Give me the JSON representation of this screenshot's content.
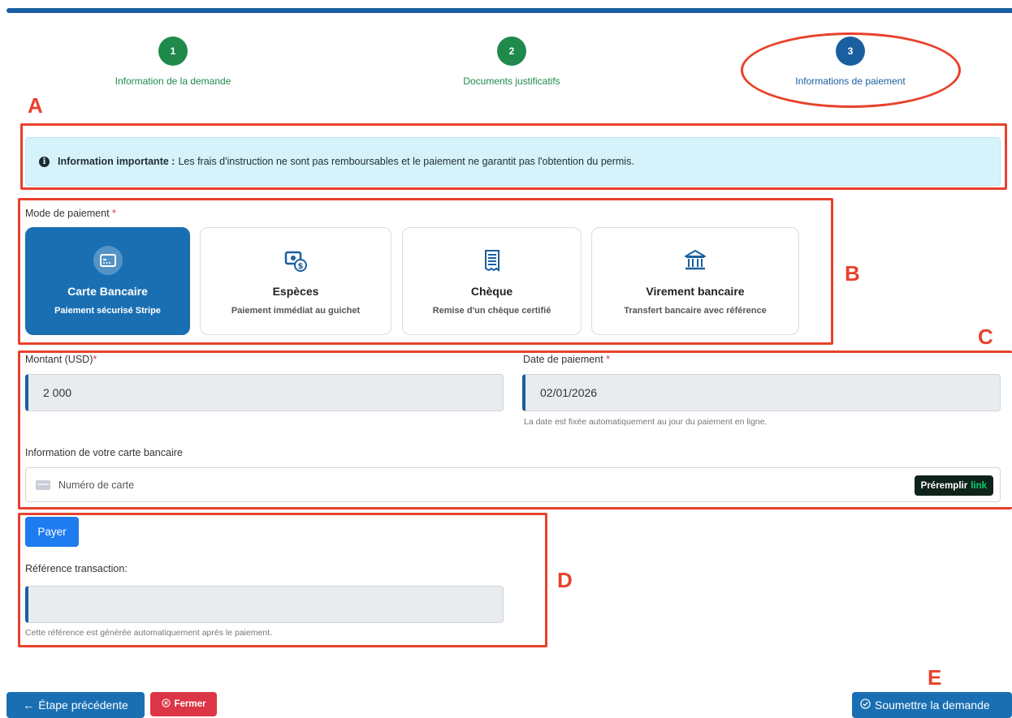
{
  "stepper": {
    "steps": [
      {
        "number": "1",
        "label": "Information de la demande"
      },
      {
        "number": "2",
        "label": "Documents justificatifs"
      },
      {
        "number": "3",
        "label": "Informations de paiement"
      }
    ]
  },
  "annotations": {
    "a": "A",
    "b": "B",
    "c": "C",
    "d": "D",
    "e": "E"
  },
  "alert": {
    "icon": "info-circle-icon",
    "title": "Information importante :",
    "text": "Les frais d'instruction ne sont pas remboursables et le paiement ne garantit pas l'obtention du permis."
  },
  "payment_mode": {
    "label": "Mode de paiement",
    "required_mark": "*",
    "options": [
      {
        "title": "Carte Bancaire",
        "subtitle": "Paiement sécurisé Stripe",
        "icon": "credit-card-icon",
        "selected": true
      },
      {
        "title": "Espèces",
        "subtitle": "Paiement immédiat au guichet",
        "icon": "cash-icon",
        "selected": false
      },
      {
        "title": "Chèque",
        "subtitle": "Remise d'un chèque certifié",
        "icon": "receipt-icon",
        "selected": false
      },
      {
        "title": "Virement bancaire",
        "subtitle": "Transfert bancaire avec référence",
        "icon": "bank-icon",
        "selected": false
      }
    ]
  },
  "amount": {
    "label": "Montant (USD)",
    "required_mark": "*",
    "value": "2 000"
  },
  "date": {
    "label": "Date de paiement",
    "required_mark": "*",
    "value": "02/01/2026",
    "help": "La date est fixée automatiquement au jour du paiement en ligne."
  },
  "card": {
    "label": "Information de votre carte bancaire",
    "placeholder": "Numéro de carte",
    "prefill_label": "Préremplir",
    "link_word": "link"
  },
  "pay_button": "Payer",
  "reference": {
    "label": "Référence transaction:",
    "value": "",
    "help": "Cette référence est générée automatiquement après le paiement."
  },
  "footer": {
    "prev_label": "Étape précédente",
    "close_label": "Fermer",
    "submit_label": "Soumettre la demande"
  },
  "colors": {
    "primary": "#1a6fb3",
    "success": "#1f8a4c",
    "danger": "#dc3545",
    "annotation": "#e8412c",
    "alert_bg": "#d6f3fb"
  }
}
